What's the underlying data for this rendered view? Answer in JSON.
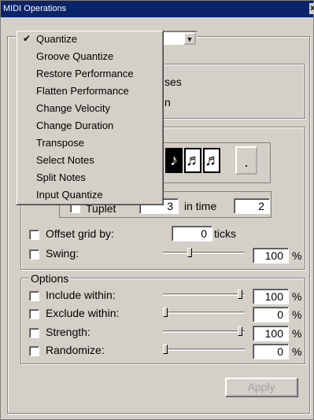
{
  "window": {
    "title": "MIDI Operations",
    "close": "x"
  },
  "bg_text": {
    "line1": "ses",
    "line2": "n"
  },
  "notes": {
    "n1": "♪",
    "n2": "♬",
    "n3": "♬",
    "dot": "."
  },
  "tuplet": {
    "label": "Tuplet",
    "value": "3",
    "in_time": "in time",
    "time_value": "2"
  },
  "offset": {
    "label": "Offset grid by:",
    "value": "0",
    "unit": "ticks"
  },
  "swing": {
    "label": "Swing:",
    "value": "100",
    "unit": "%",
    "level": 0.32
  },
  "options": {
    "title": "Options",
    "rows": [
      {
        "label": "Include within:",
        "value": "100",
        "unit": "%",
        "level": 0.97
      },
      {
        "label": "Exclude within:",
        "value": "0",
        "unit": "%",
        "level": 0.0
      },
      {
        "label": "Strength:",
        "value": "100",
        "unit": "%",
        "level": 0.97
      },
      {
        "label": "Randomize:",
        "value": "0",
        "unit": "%",
        "level": 0.0
      }
    ]
  },
  "apply_label": "Apply",
  "menu": {
    "items": [
      {
        "label": "Quantize",
        "checked": true
      },
      {
        "label": "Groove Quantize"
      },
      {
        "label": "Restore Performance"
      },
      {
        "label": "Flatten Performance"
      },
      {
        "label": "Change Velocity"
      },
      {
        "label": "Change Duration"
      },
      {
        "label": "Transpose"
      },
      {
        "label": "Select Notes"
      },
      {
        "label": "Split Notes"
      },
      {
        "label": "Input Quantize"
      }
    ],
    "check_glyph": "✔",
    "arrow_glyph": "▼"
  }
}
